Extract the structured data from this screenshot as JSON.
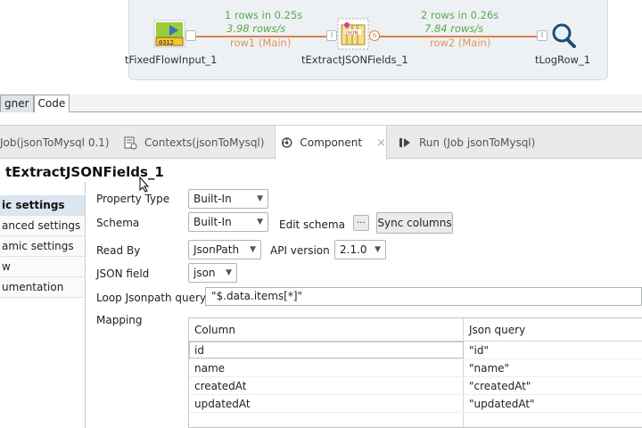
{
  "canvas": {
    "components": [
      {
        "name": "tFixedFlowInput_1",
        "icon": "fixed-flow-input-icon"
      },
      {
        "name": "tExtractJSONFields_1",
        "icon": "json-extract-icon"
      },
      {
        "name": "tLogRow_1",
        "icon": "log-row-magnifier-icon"
      }
    ],
    "links": [
      {
        "rows": "1 rows in 0.25s",
        "rate": "3.98 rows/s",
        "label": "row1 (Main)"
      },
      {
        "rows": "2 rows in 0.26s",
        "rate": "7.84 rows/s",
        "label": "row2 (Main)"
      }
    ],
    "colors": {
      "stats": "#57a84a",
      "link": "#d7834a"
    }
  },
  "editor_tabs": [
    "gner",
    "Code"
  ],
  "view_tabs": [
    {
      "label": "Job(jsonToMysql 0.1)",
      "icon": "job-icon"
    },
    {
      "label": "Contexts(jsonToMysql)",
      "icon": "contexts-icon"
    },
    {
      "label": "Component",
      "icon": "component-icon"
    },
    {
      "label": "Run (Job jsonToMysql)",
      "icon": "run-icon"
    }
  ],
  "component_title": "tExtractJSONFields_1",
  "side_nav": [
    "ic settings",
    "anced settings",
    "amic settings",
    "w",
    "umentation"
  ],
  "form": {
    "property_type": {
      "label": "Property Type",
      "value": "Built-In"
    },
    "schema": {
      "label": "Schema",
      "value": "Built-In",
      "edit_label": "Edit schema",
      "ellipsis": "...",
      "sync_label": "Sync columns"
    },
    "read_by": {
      "label": "Read By",
      "value": "JsonPath",
      "api_label": "API version",
      "api_value": "2.1.0"
    },
    "json_field": {
      "label": "JSON field",
      "value": "json"
    },
    "loop_query": {
      "label": "Loop Jsonpath query",
      "value": "\"$.data.items[*]\""
    },
    "mapping_label": "Mapping"
  },
  "mapping": {
    "headers": [
      "Column",
      "Json query"
    ],
    "rows": [
      [
        "id",
        "\"id\""
      ],
      [
        "name",
        "\"name\""
      ],
      [
        "createdAt",
        "\"createdAt\""
      ],
      [
        "updatedAt",
        "\"updatedAt\""
      ]
    ]
  }
}
